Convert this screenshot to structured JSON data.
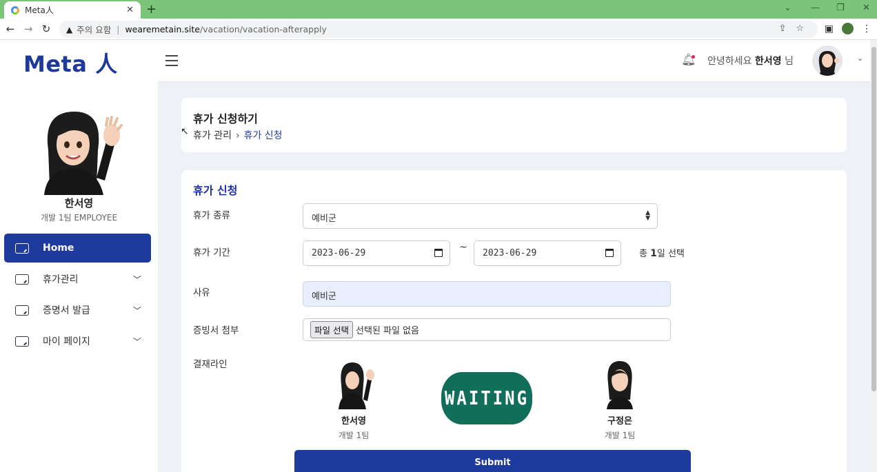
{
  "browser": {
    "tab_title": "Meta人",
    "address_warning": "주의 요함",
    "url_host": "wearemetain.site",
    "url_path": "/vacation/vacation-afterapply"
  },
  "header": {
    "logo": "Meta 人",
    "greeting_prefix": "안녕하세요",
    "user_name": "한서영",
    "greeting_suffix": "님"
  },
  "sidebar": {
    "name": "한서영",
    "dept": "개발 1팀 EMPLOYEE",
    "items": [
      {
        "label": "Home",
        "icon": "chat-icon"
      },
      {
        "label": "휴가관리",
        "icon": "edit-icon"
      },
      {
        "label": "증명서 발급",
        "icon": "edit-icon"
      },
      {
        "label": "마이 페이지",
        "icon": "edit-icon"
      }
    ]
  },
  "page": {
    "title": "휴가 신청하기",
    "breadcrumb_parent": "휴가 관리",
    "breadcrumb_current": "휴가 신청"
  },
  "form": {
    "title": "휴가 신청",
    "type_label": "휴가 종류",
    "type_value": "예비군",
    "period_label": "휴가 기간",
    "start_date": "2023-06-29",
    "end_date": "2023-06-29",
    "tilde": "~",
    "total_prefix": "총",
    "total_days": "1",
    "total_suffix": "일 선택",
    "reason_label": "사유",
    "reason_value": "예비군",
    "attach_label": "증빙서 첨부",
    "file_button": "파일 선택",
    "file_status": "선택된 파일 없음",
    "approval_label": "결재라인",
    "approvers": [
      {
        "name": "한서영",
        "dept": "개발 1팀"
      },
      {
        "name": "구정은",
        "dept": "개발 1팀"
      }
    ],
    "status": "WAITING",
    "submit_label": "Submit"
  },
  "colors": {
    "brand": "#1e3a9c",
    "waiting": "#106e5b",
    "chrome_green": "#7cc47a"
  }
}
